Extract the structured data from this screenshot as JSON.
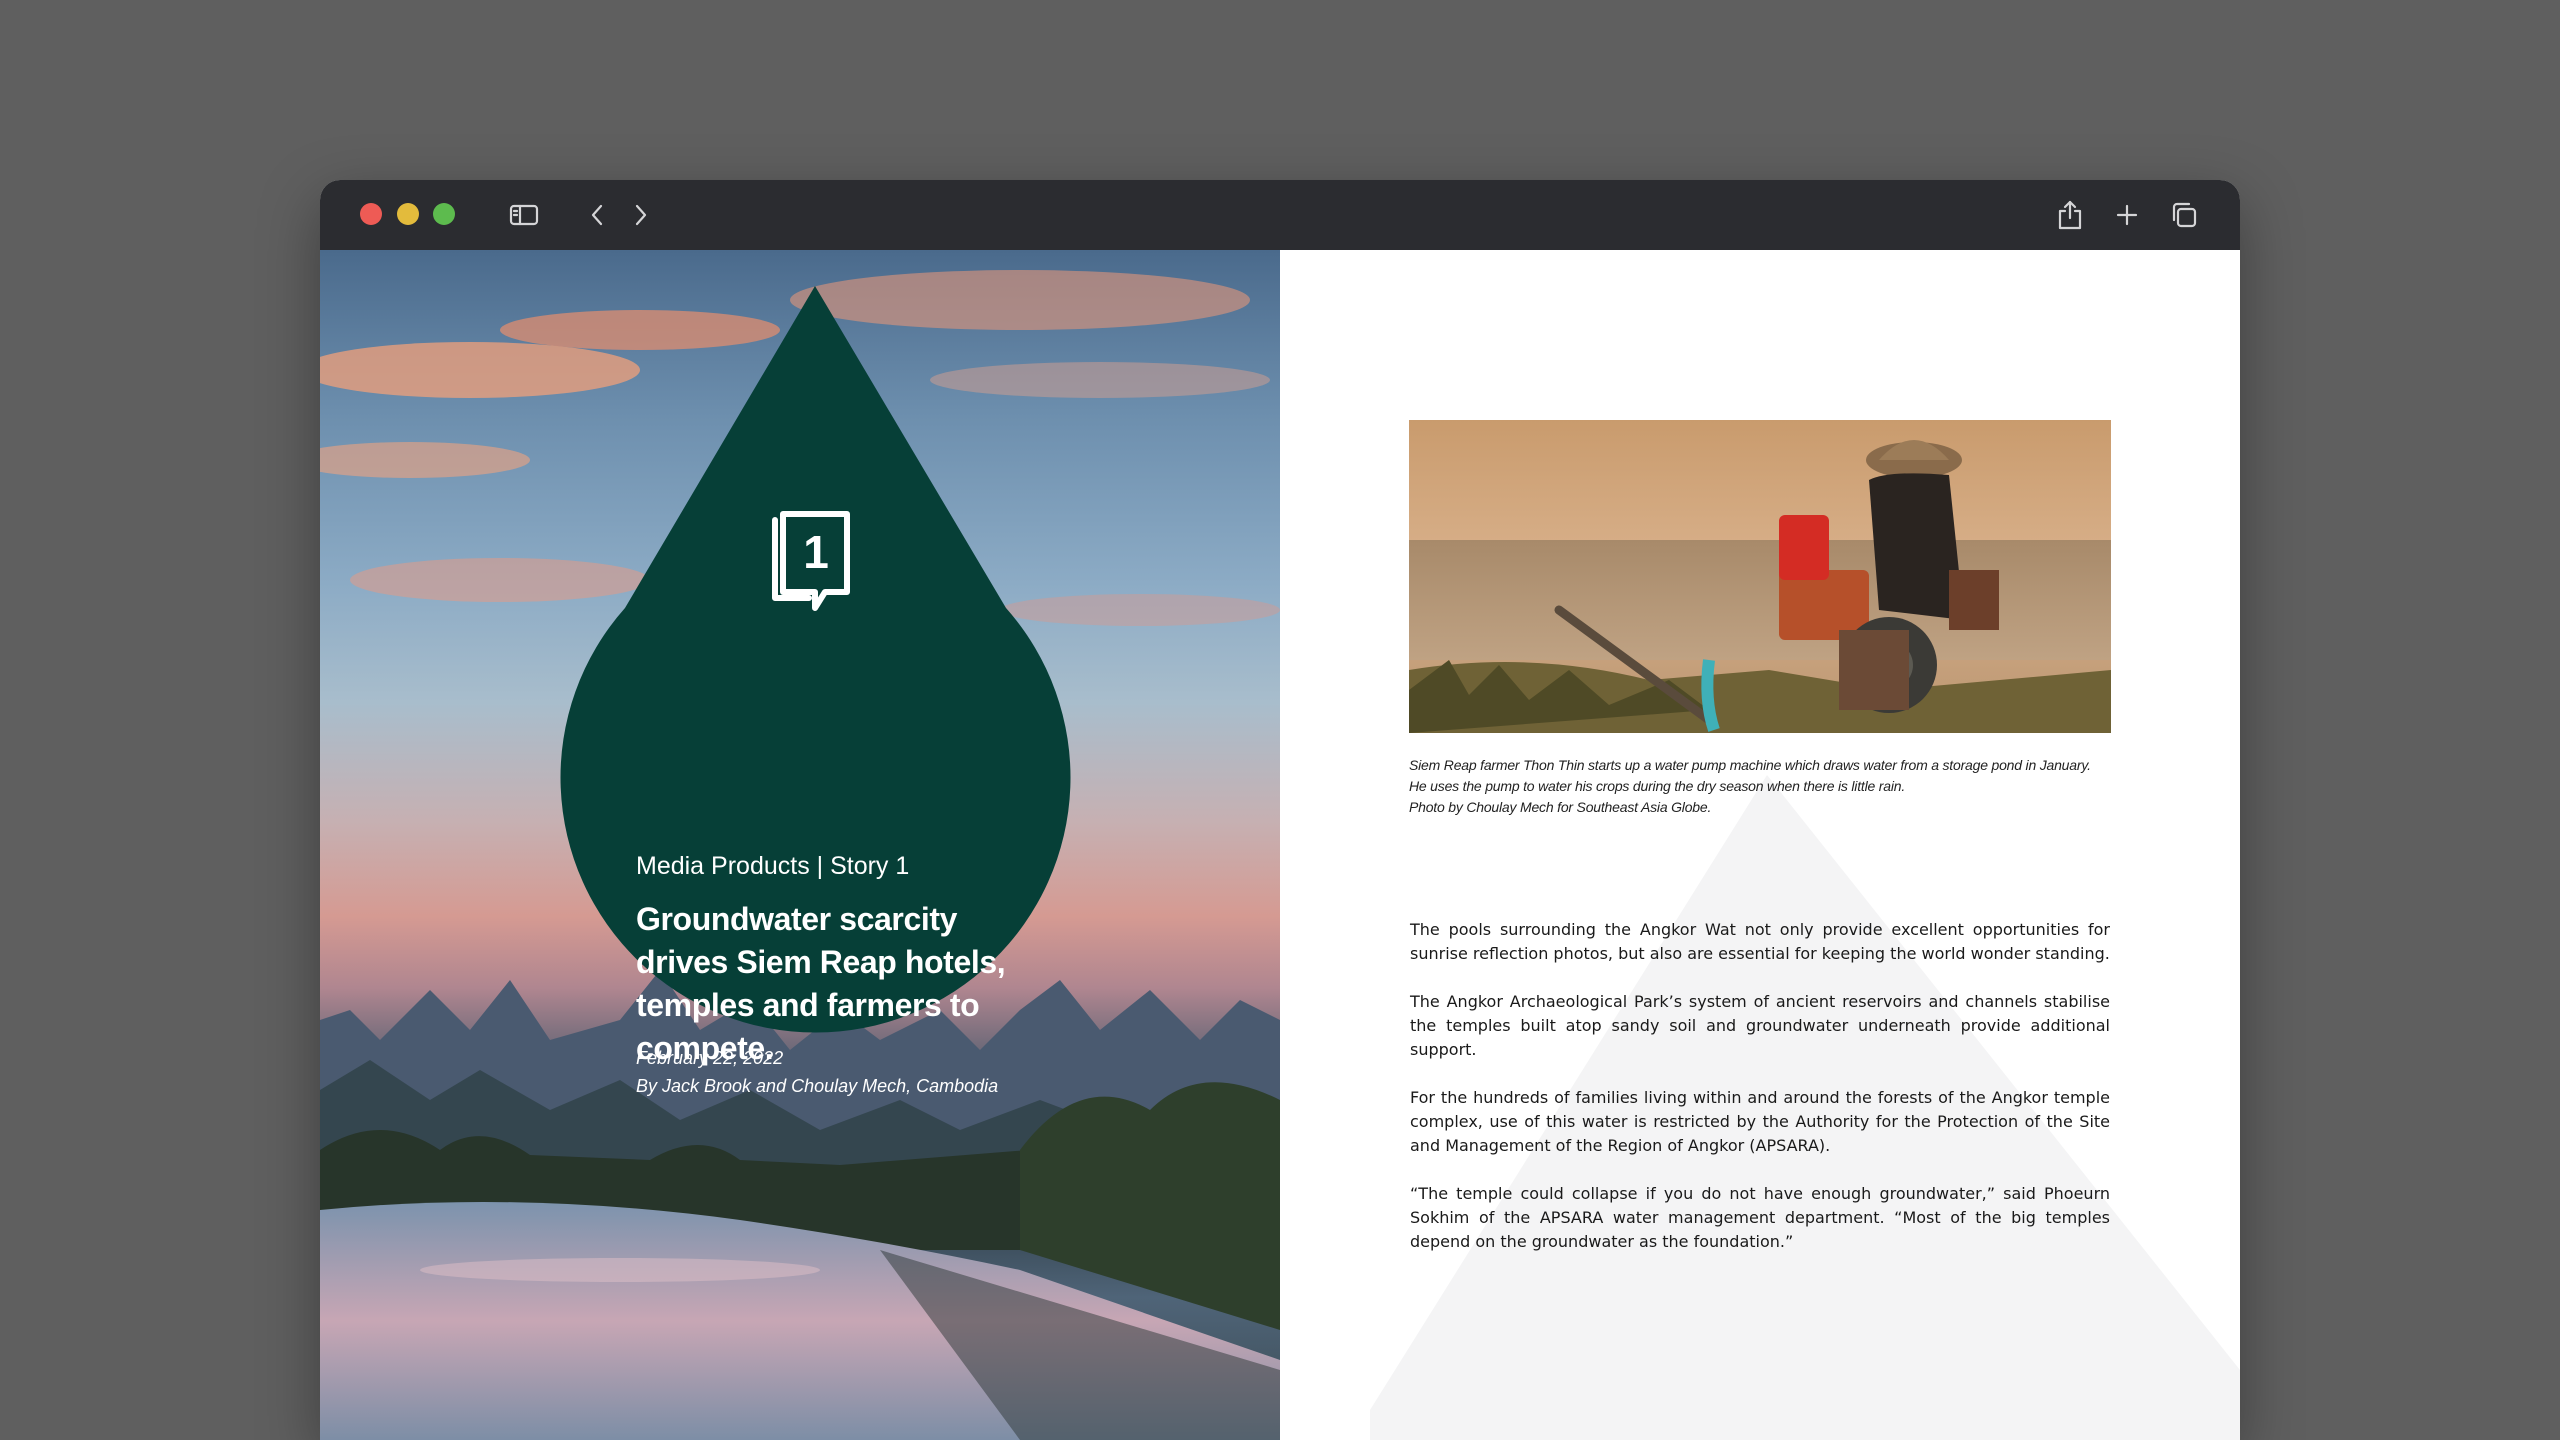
{
  "window": {
    "toolbar": {
      "traffic_lights": {
        "close": "#ee5b55",
        "minimize": "#e3bb3c",
        "maximize": "#5dbb4e"
      },
      "icons": [
        "sidebar-icon",
        "back-chevron-icon",
        "forward-chevron-icon",
        "share-icon",
        "plus-icon",
        "tabs-overview-icon"
      ]
    }
  },
  "cover": {
    "story_number": "1",
    "kicker": "Media Products | Story 1",
    "title": "Groundwater scarcity drives Siem Reap hotels, temples and farmers to compete.",
    "date": "February 22, 2022",
    "byline": "By Jack Brook and Choulay Mech, Cambodia",
    "drop_color": "#063f37"
  },
  "article": {
    "photo_caption": [
      "Siem Reap farmer Thon Thin starts up a water pump machine which draws water from a storage pond in January.",
      "He uses the pump to water his crops during the dry season when there is little rain.",
      "Photo by Choulay Mech for Southeast Asia Globe."
    ],
    "paragraphs": [
      "The pools surrounding the Angkor Wat not only provide excellent opportunities for sunrise reflection photos, but also are essential for keeping the world wonder standing.",
      "The Angkor Archaeological Park’s system of ancient reservoirs and channels stabilise the temples built atop sandy soil and groundwater underneath provide additional support.",
      "For the hundreds of families living within and around the forests of the Angkor temple complex, use of this water is restricted by the Authority for the Protection of the Site and Management of the Region of Angkor (APSARA).",
      "“The temple could collapse if you do not have enough groundwater,” said Phoeurn Sokhim of the APSARA water management department. “Most of the big temples depend on the groundwater as the foundation.”"
    ]
  }
}
